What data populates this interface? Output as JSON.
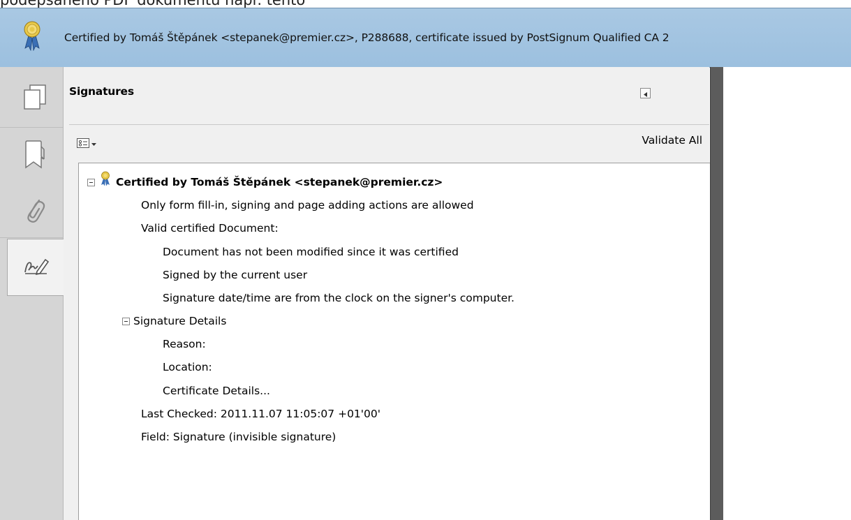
{
  "caption": "podepsaného PDF dokumentu např. tento",
  "topbar": {
    "message": "Certified by Tomáš Štěpánek <stepanek@premier.cz>, P288688, certificate issued by PostSignum Qualified CA 2",
    "icon": "certified-ribbon-icon"
  },
  "nav": {
    "items": [
      {
        "name": "pages",
        "icon": "pages-icon"
      },
      {
        "name": "bookmarks",
        "icon": "bookmark-icon"
      },
      {
        "name": "attachments",
        "icon": "paperclip-icon"
      },
      {
        "name": "signatures",
        "icon": "signature-pen-icon",
        "active": true
      }
    ]
  },
  "panel": {
    "title": "Signatures",
    "validate_all": "Validate All"
  },
  "tree": {
    "root": "Certified by Tomáš Štěpánek <stepanek@premier.cz>",
    "permissions": "Only form fill-in, signing and page adding actions are allowed",
    "valid_heading": "Valid certified Document:",
    "valid_items": [
      "Document has not been modified since it was certified",
      "Signed by the current user",
      "Signature date/time are from the clock on the signer's computer."
    ],
    "details_heading": "Signature Details",
    "details_items": [
      "Reason:",
      "Location:",
      "Certificate Details..."
    ],
    "last_checked": "Last Checked: 2011.11.07 11:05:07 +01'00'",
    "field": "Field: Signature (invisible signature)"
  },
  "colors": {
    "topbar": "#a9c8e3",
    "navbar": "#d5d5d5",
    "panel": "#f0f0f0",
    "ribbon_blue": "#3a6fb5",
    "ribbon_yellow": "#e8c94a"
  }
}
